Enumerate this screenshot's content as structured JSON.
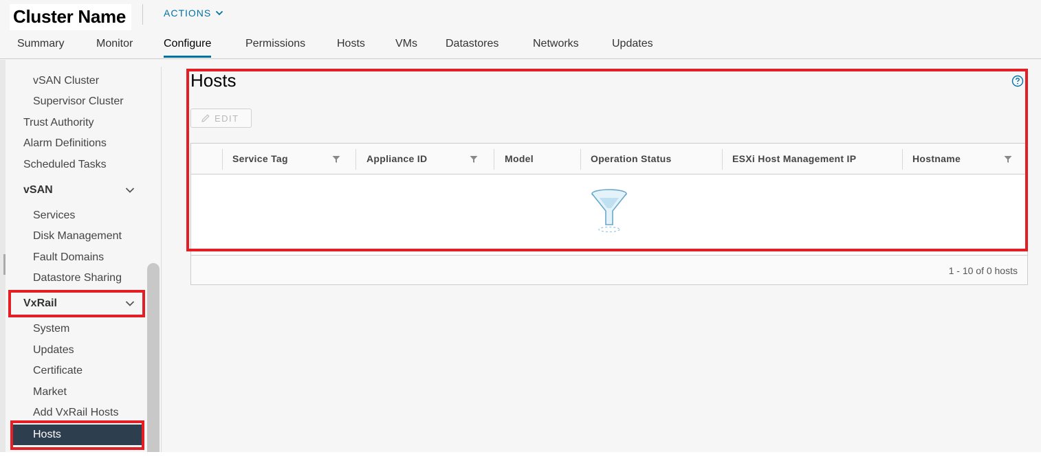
{
  "header": {
    "title": "Cluster Name",
    "actions_label": "ACTIONS"
  },
  "tabs": [
    {
      "label": "Summary",
      "active": false
    },
    {
      "label": "Monitor",
      "active": false
    },
    {
      "label": "Configure",
      "active": true
    },
    {
      "label": "Permissions",
      "active": false
    },
    {
      "label": "Hosts",
      "active": false
    },
    {
      "label": "VMs",
      "active": false
    },
    {
      "label": "Datastores",
      "active": false
    },
    {
      "label": "Networks",
      "active": false
    },
    {
      "label": "Updates",
      "active": false
    }
  ],
  "sidebar": {
    "items": [
      {
        "label": "vSAN Cluster"
      },
      {
        "label": "Supervisor Cluster"
      },
      {
        "label": "Trust Authority"
      },
      {
        "label": "Alarm Definitions"
      },
      {
        "label": "Scheduled Tasks"
      }
    ],
    "vsan_group": {
      "label": "vSAN",
      "items": [
        {
          "label": "Services"
        },
        {
          "label": "Disk Management"
        },
        {
          "label": "Fault Domains"
        },
        {
          "label": "Datastore Sharing"
        }
      ]
    },
    "vxrail_group": {
      "label": "VxRail",
      "items": [
        {
          "label": "System"
        },
        {
          "label": "Updates"
        },
        {
          "label": "Certificate"
        },
        {
          "label": "Market"
        },
        {
          "label": "Add VxRail Hosts"
        },
        {
          "label": "Hosts",
          "selected": true
        }
      ]
    }
  },
  "main": {
    "title": "Hosts",
    "edit_label": "EDIT",
    "columns": [
      {
        "label": "Service Tag",
        "filterable": true
      },
      {
        "label": "Appliance ID",
        "filterable": true
      },
      {
        "label": "Model",
        "filterable": false
      },
      {
        "label": "Operation Status",
        "filterable": false
      },
      {
        "label": "ESXi Host Management IP",
        "filterable": false
      },
      {
        "label": "Hostname",
        "filterable": true
      }
    ],
    "rows": [],
    "footer": "1 - 10 of 0 hosts"
  },
  "colors": {
    "accent": "#0072a3",
    "selected_bg": "#2d3e4e",
    "highlight_border": "#e31e24"
  }
}
